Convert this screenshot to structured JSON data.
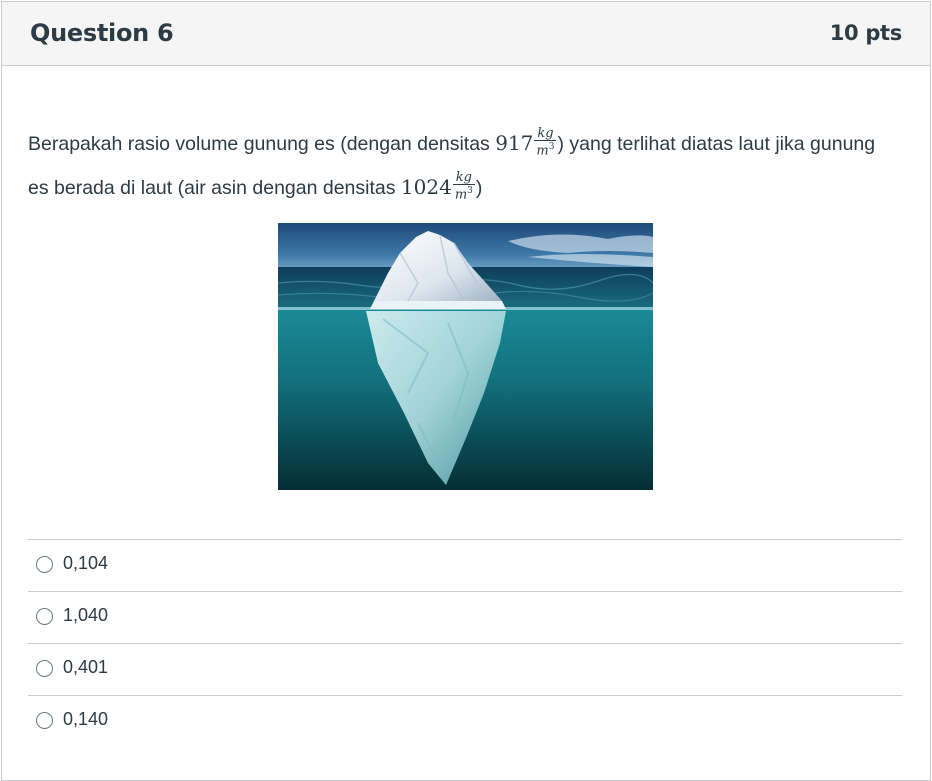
{
  "question": {
    "title": "Question 6",
    "points": "10 pts",
    "text_part1": "Berapakah rasio volume gunung es (dengan densitas ",
    "density_ice": "917",
    "unit_num": "kg",
    "unit_den": "m",
    "unit_den_exp": "3",
    "text_part2": ") yang terlihat diatas laut jika gunung es berada di laut (air asin dengan densitas ",
    "density_seawater": "1024",
    "text_part3": ")"
  },
  "answers": [
    {
      "label": "0,104"
    },
    {
      "label": "1,040"
    },
    {
      "label": "0,401"
    },
    {
      "label": "0,140"
    }
  ]
}
